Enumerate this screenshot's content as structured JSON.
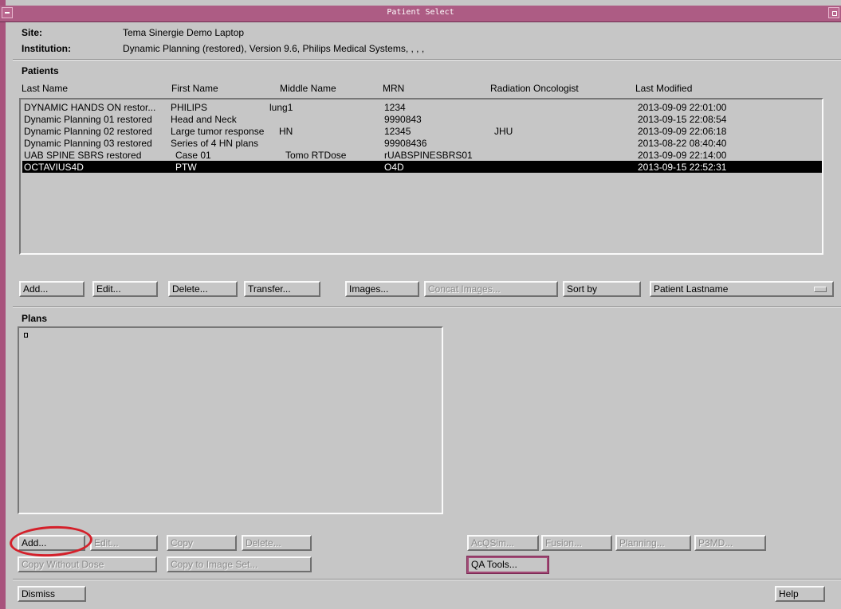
{
  "window": {
    "title": "Patient Select"
  },
  "site": {
    "label": "Site:",
    "value": "Tema Sinergie Demo Laptop"
  },
  "institution": {
    "label": "Institution:",
    "value": "Dynamic Planning (restored), Version 9.6, Philips Medical Systems, , , ,"
  },
  "patients": {
    "heading": "Patients",
    "columns": [
      "Last Name",
      "First Name",
      "Middle Name",
      "MRN",
      "Radiation Oncologist",
      "Last Modified"
    ],
    "rows": [
      [
        "DYNAMIC HANDS ON restor...",
        "PHILIPS",
        "lung1",
        "1234",
        "",
        "2013-09-09 22:01:00"
      ],
      [
        "Dynamic Planning 01 restored",
        "Head and Neck",
        "",
        "9990843",
        "",
        "2013-09-15 22:08:54"
      ],
      [
        "Dynamic Planning 02 restored",
        "Large tumor response",
        "HN",
        "12345",
        "JHU",
        "2013-09-09 22:06:18"
      ],
      [
        "Dynamic Planning 03 restored",
        "Series of 4 HN plans",
        "",
        "99908436",
        "",
        "2013-08-22 08:40:40"
      ],
      [
        "UAB SPINE SBRS restored",
        "Case 01",
        "Tomo RTDose",
        "rUABSPINESBRS01",
        "",
        "2013-09-09 22:14:00"
      ],
      [
        "OCTAVIUS4D",
        "PTW",
        "",
        "O4D",
        "",
        "2013-09-15 22:52:31"
      ]
    ],
    "selected_index": 5,
    "buttons": {
      "add": "Add...",
      "edit": "Edit...",
      "delete": "Delete...",
      "transfer": "Transfer...",
      "images": "Images...",
      "concat_images": "Concat Images...",
      "sort_by": "Sort by"
    },
    "sort_value": "Patient Lastname"
  },
  "plans": {
    "heading": "Plans",
    "buttons": {
      "add": "Add...",
      "edit": "Edit...",
      "copy": "Copy",
      "delete": "Delete...",
      "copy_without_dose": "Copy Without Dose",
      "copy_to_image_set": "Copy to Image Set...",
      "acqsim": "AcQSim...",
      "fusion": "Fusion...",
      "planning": "Planning...",
      "p3md": "P3MD...",
      "qa_tools": "QA Tools..."
    }
  },
  "footer": {
    "dismiss": "Dismiss",
    "help": "Help"
  },
  "colors": {
    "title_bar": "#ad5c84",
    "selection": "#000000",
    "annotation_circle": "#d4202a"
  }
}
